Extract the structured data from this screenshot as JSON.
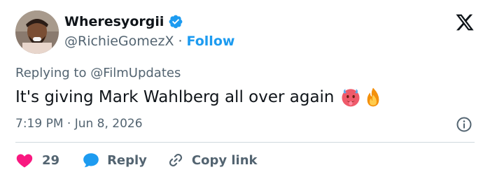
{
  "author": {
    "display_name": "Wheresyorgii",
    "handle": "@RichieGomezX",
    "separator": "·",
    "follow_label": "Follow",
    "verified_color": "#1d9bf0"
  },
  "reply_context": "Replying to @FilmUpdates",
  "tweet": {
    "text": "It's giving Mark Wahlberg all over again",
    "emojis": [
      "hot-face-emoji",
      "fire-emoji"
    ]
  },
  "timestamp": "7:19 PM · Jun 8, 2026",
  "actions": {
    "like_count": "29",
    "reply_label": "Reply",
    "copy_link_label": "Copy link"
  },
  "colors": {
    "accent": "#1d9bf0",
    "like": "#f91880",
    "muted": "#536471",
    "text": "#0f1419"
  }
}
